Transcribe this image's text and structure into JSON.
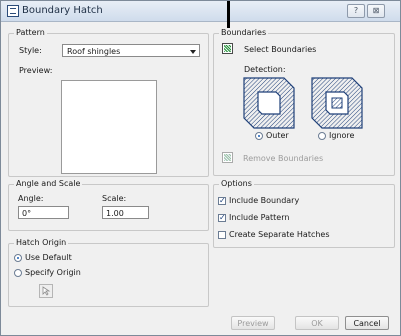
{
  "window": {
    "title": "Boundary Hatch",
    "help_label": "?",
    "close_label": "⊠"
  },
  "pattern": {
    "group_label": "Pattern",
    "style_label": "Style:",
    "style_value": "Roof shingles",
    "preview_label": "Preview:"
  },
  "boundaries": {
    "group_label": "Boundaries",
    "select_label": "Select Boundaries",
    "detection_label": "Detection:",
    "outer_label": "Outer",
    "ignore_label": "Ignore",
    "remove_label": "Remove Boundaries",
    "selected_detection": "Outer"
  },
  "angle_scale": {
    "group_label": "Angle and Scale",
    "angle_label": "Angle:",
    "angle_value": "0°",
    "scale_label": "Scale:",
    "scale_value": "1.00"
  },
  "options": {
    "group_label": "Options",
    "include_boundary": "Include Boundary",
    "include_pattern": "Include Pattern",
    "separate_hatches": "Create Separate Hatches",
    "checked": {
      "include_boundary": true,
      "include_pattern": true,
      "separate_hatches": false
    }
  },
  "hatch_origin": {
    "group_label": "Hatch Origin",
    "use_default": "Use Default",
    "specify_origin": "Specify Origin",
    "selected": "Use Default"
  },
  "footer": {
    "preview_label": "Preview",
    "ok_label": "OK",
    "cancel_label": "Cancel"
  }
}
